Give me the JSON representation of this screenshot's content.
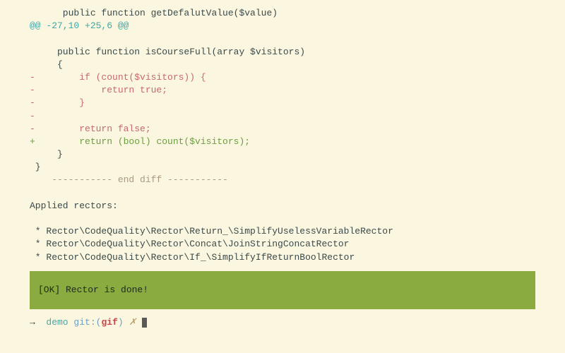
{
  "diff": {
    "context_top": "      public function getDefalutValue($value)",
    "hunk": "@@ -27,10 +25,6 @@",
    "blank1": " ",
    "fn_decl": "     public function isCourseFull(array $visitors)",
    "brace_open": "     {",
    "removed": [
      "-        if (count($visitors)) {",
      "-            return true;",
      "-        }",
      "-",
      "-        return false;"
    ],
    "added": "+        return (bool) count($visitors);",
    "brace_close": "     }",
    "outer_brace": " }",
    "end_marker": "    ----------- end diff -----------"
  },
  "applied": {
    "heading": "Applied rectors:",
    "items": [
      " * Rector\\CodeQuality\\Rector\\Return_\\SimplifyUselessVariableRector",
      " * Rector\\CodeQuality\\Rector\\Concat\\JoinStringConcatRector",
      " * Rector\\CodeQuality\\Rector\\If_\\SimplifyIfReturnBoolRector"
    ]
  },
  "banner": "[OK] Rector is done!",
  "prompt": {
    "arrow": "→  ",
    "dir": "demo ",
    "git_label": "git:(",
    "branch": "gif",
    "git_close": ") ",
    "x": "✗ "
  }
}
